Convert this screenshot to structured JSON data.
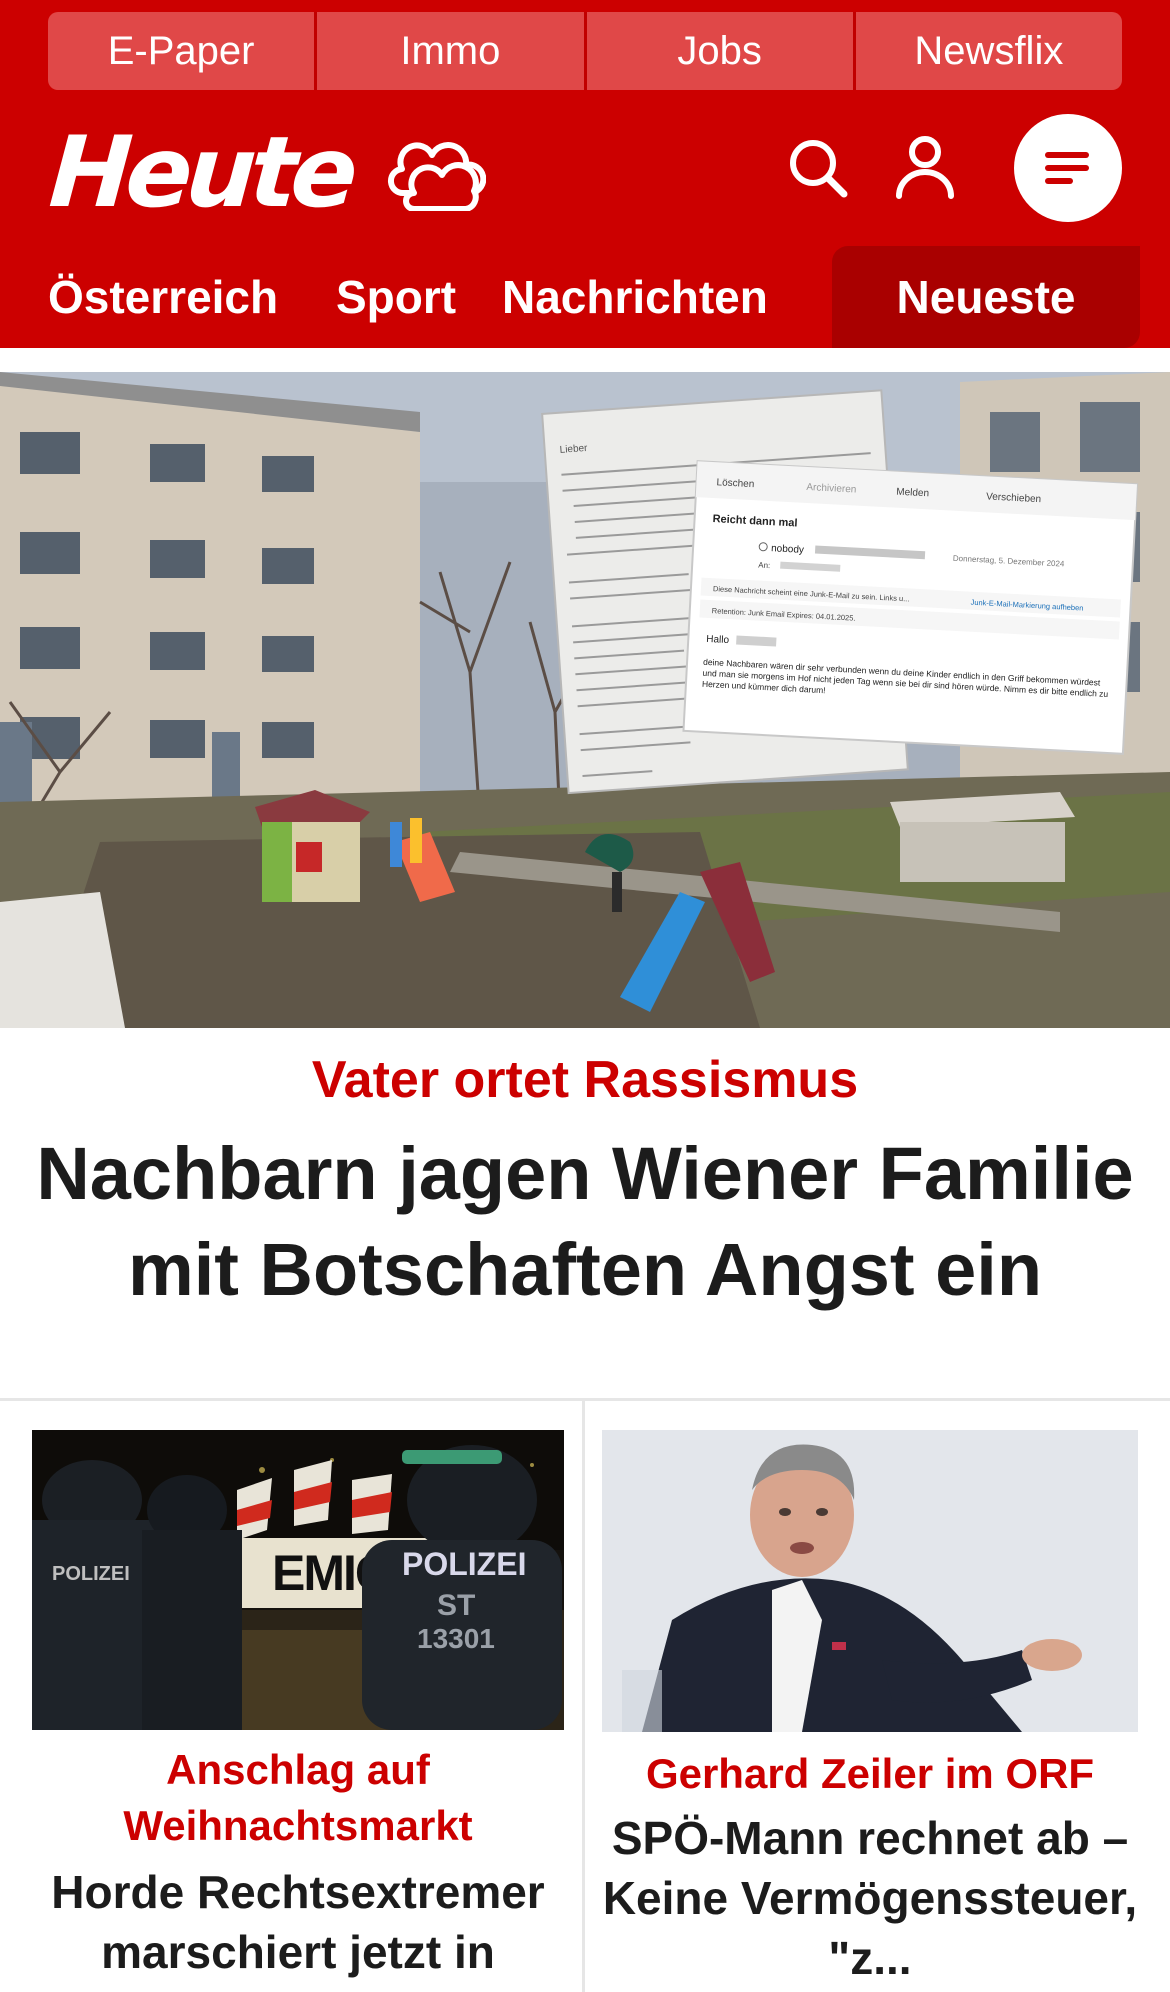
{
  "top_nav": {
    "items": [
      {
        "label": "E-Paper"
      },
      {
        "label": "Immo"
      },
      {
        "label": "Jobs"
      },
      {
        "label": "Newsflix"
      }
    ]
  },
  "brand": {
    "logo_text": "Heute",
    "weather_icon": "cloud-sun-icon"
  },
  "header_icons": [
    "search-icon",
    "user-icon",
    "menu-icon"
  ],
  "section_nav": {
    "items": [
      {
        "label": "Österreich"
      },
      {
        "label": "Sport"
      },
      {
        "label": "Nachrichten"
      }
    ],
    "highlight": "Neueste"
  },
  "hero": {
    "kicker": "Vater ortet Rassismus",
    "title": "Nachbarn jagen Wiener Familie mit Botschaften Angst ein",
    "image": {
      "letter_heading": "Lieber",
      "mail_toolbar": [
        "Löschen",
        "Archivieren",
        "Melden",
        "Verschieben"
      ],
      "mail_subject": "Reicht dann mal",
      "mail_from": "nobody",
      "mail_date": "Donnerstag, 5. Dezember 2024",
      "mail_to_label": "An:",
      "junk_notice": "Diese Nachricht scheint eine Junk-E-Mail zu sein. Links u...",
      "junk_link": "Junk-E-Mail-Markierung aufheben",
      "retention": "Retention: Junk Email Expires: 04.01.2025.",
      "greeting": "Hallo",
      "body": "deine Nachbaren wären dir sehr verbunden wenn du deine Kinder endlich in den Griff bekommen würdest und man sie morgens im Hof nicht jeden Tag wenn sie bei dir sind hören würde. Nimm es dir bitte endlich zu Herzen und kümmer dich darum!"
    }
  },
  "teasers": [
    {
      "kicker": "Anschlag auf Weihnachtsmarkt",
      "title": "Horde Rechtsextremer marschiert jetzt in",
      "image_text": {
        "banner": "EMIGR",
        "police": "POLIZEI",
        "unit": "ST",
        "number": "13301"
      }
    },
    {
      "kicker": "Gerhard Zeiler im ORF",
      "title": "SPÖ-Mann rechnet ab – Keine Vermögenssteuer, \"z..."
    }
  ],
  "colors": {
    "brand_red": "#cc0000",
    "nav_tab": "#e04848",
    "highlight_tab": "#a90000",
    "title_text": "#1c1c1c"
  }
}
